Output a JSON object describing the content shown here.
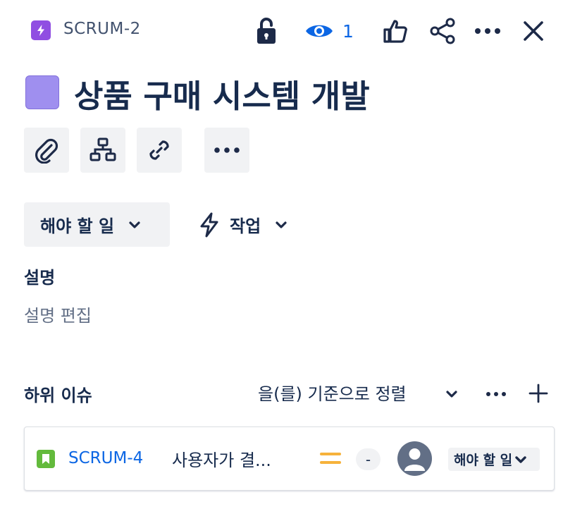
{
  "header": {
    "issue_key": "SCRUM-2",
    "issue_type_icon": "lightning-bolt-icon",
    "watch_count": "1",
    "icons": [
      "unlock-icon",
      "eye-icon",
      "thumbs-up-icon",
      "share-icon",
      "more-icon",
      "close-icon"
    ]
  },
  "issue": {
    "title": "상품 구매 시스템 개발",
    "color": "#9f8fef"
  },
  "actions": [
    "paperclip-icon",
    "child-issues-icon",
    "link-icon",
    "more-icon"
  ],
  "status": {
    "label": "해야 할 일",
    "issue_type_label": "작업"
  },
  "description": {
    "heading": "설명",
    "placeholder": "설명 편집"
  },
  "subtasks": {
    "heading": "하위 이슈",
    "sort_label": "을(를) 기준으로 정렬",
    "items": [
      {
        "key": "SCRUM-4",
        "summary": "사용자가 결...",
        "type_icon": "story-icon",
        "priority": "medium",
        "estimate": "-",
        "status": "해야 할 일"
      }
    ]
  },
  "colors": {
    "accent": "#0c66e4",
    "epic": "#904ee2",
    "story": "#63ba3c",
    "priority_medium": "#f6b23b"
  }
}
